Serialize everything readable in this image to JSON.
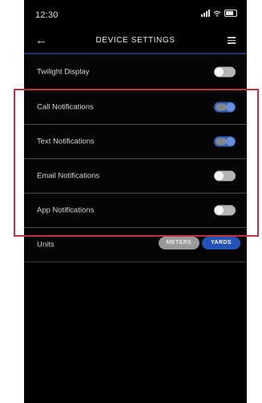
{
  "status_bar": {
    "time": "12:30"
  },
  "header": {
    "title": "DEVICE SETTINGS",
    "back_icon": "arrow-left-icon",
    "menu_icon": "hamburger-menu-icon"
  },
  "settings": [
    {
      "label": "Twilight Display",
      "enabled": false
    },
    {
      "label": "Call Notifications",
      "enabled": true
    },
    {
      "label": "Text Notifications",
      "enabled": true
    },
    {
      "label": "Email Notifications",
      "enabled": false
    },
    {
      "label": "App Notifications",
      "enabled": false
    }
  ],
  "units": {
    "label": "Units",
    "options": [
      "METERS",
      "YARDS"
    ],
    "selected": "YARDS"
  },
  "colors": {
    "accent": "#2552b6",
    "highlight_border": "#c5323f",
    "background": "#000000"
  }
}
